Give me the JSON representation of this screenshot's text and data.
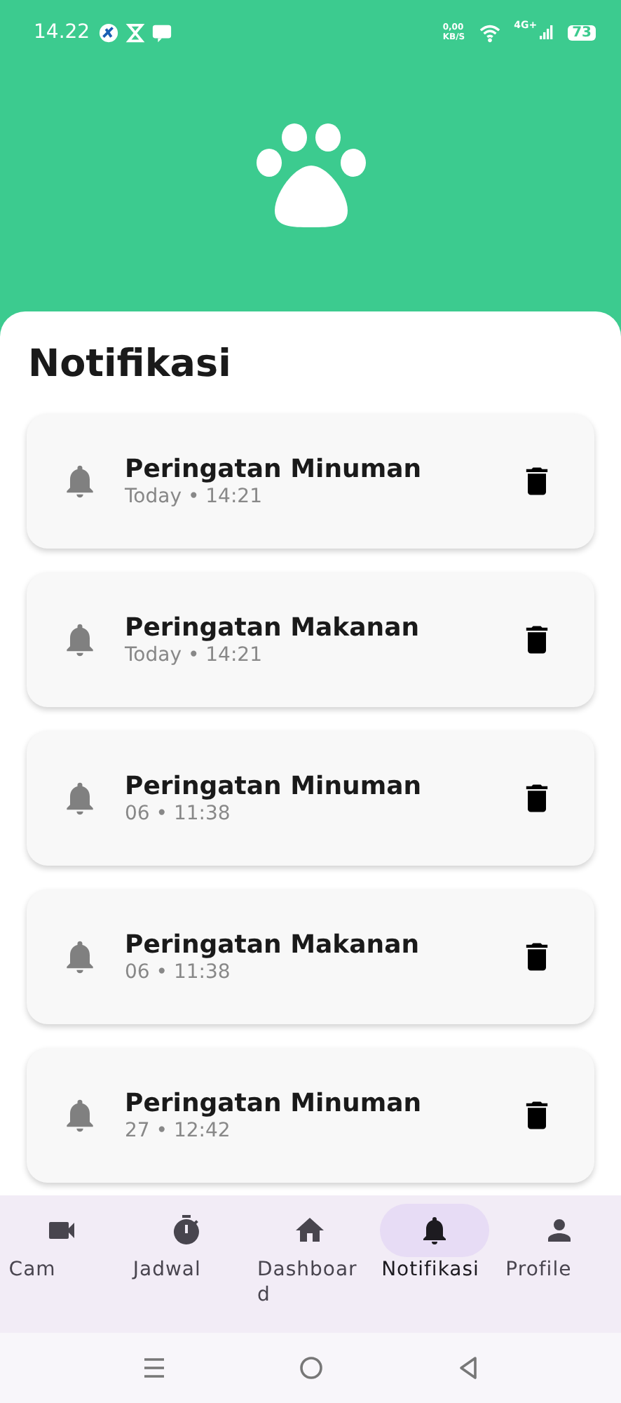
{
  "status_bar": {
    "time": "14.22",
    "net_speed": "0,00",
    "net_unit": "KB/S",
    "network": "4G+",
    "battery": "73"
  },
  "title": "Notifikasi",
  "notifications": [
    {
      "title": "Peringatan Minuman",
      "time": "Today • 14:21"
    },
    {
      "title": "Peringatan Makanan",
      "time": "Today • 14:21"
    },
    {
      "title": "Peringatan Minuman",
      "time": "06 • 11:38"
    },
    {
      "title": "Peringatan Makanan",
      "time": "06 • 11:38"
    },
    {
      "title": "Peringatan Minuman",
      "time": "27 • 12:42"
    }
  ],
  "nav": [
    {
      "kind": "cam",
      "label": "Cam",
      "selected": false
    },
    {
      "kind": "timer",
      "label": "Jadwal",
      "selected": false
    },
    {
      "kind": "home",
      "label": "Dashboard",
      "selected": false
    },
    {
      "kind": "bell",
      "label": "Notifikasi",
      "selected": true
    },
    {
      "kind": "person",
      "label": "Profile",
      "selected": false
    }
  ]
}
